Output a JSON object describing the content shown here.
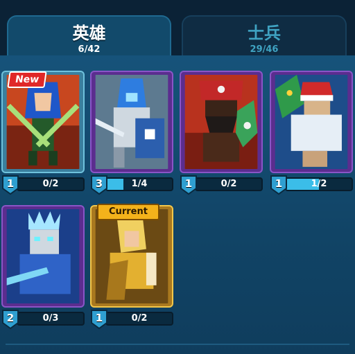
{
  "tabs": [
    {
      "title": "英雄",
      "count": "6/42",
      "active": true
    },
    {
      "title": "士兵",
      "count": "29/46",
      "active": false
    }
  ],
  "cards": [
    {
      "art": "dual-sword-ninja-hero",
      "frame": "teal",
      "badge": "New",
      "level": "1",
      "progress": "0/2",
      "fill": 0.0
    },
    {
      "art": "armored-blue-knight-hero",
      "frame": "purple",
      "badge": null,
      "level": "3",
      "progress": "1/4",
      "fill": 0.25
    },
    {
      "art": "pirate-with-bottle-hero",
      "frame": "purple",
      "badge": null,
      "level": "1",
      "progress": "0/2",
      "fill": 0.0
    },
    {
      "art": "santa-hat-brawler-hero",
      "frame": "purple",
      "badge": null,
      "level": "1",
      "progress": "1/2",
      "fill": 0.5
    },
    {
      "art": "ice-king-hero",
      "frame": "purple",
      "badge": null,
      "level": "2",
      "progress": "0/3",
      "fill": 0.0
    },
    {
      "art": "golden-paladin-hero",
      "frame": "gold",
      "badge": "Current",
      "level": "1",
      "progress": "0/2",
      "fill": 0.0
    }
  ],
  "colors": {
    "progress_fill": "#3bbde8",
    "level_badge": "#2f9fd0"
  }
}
